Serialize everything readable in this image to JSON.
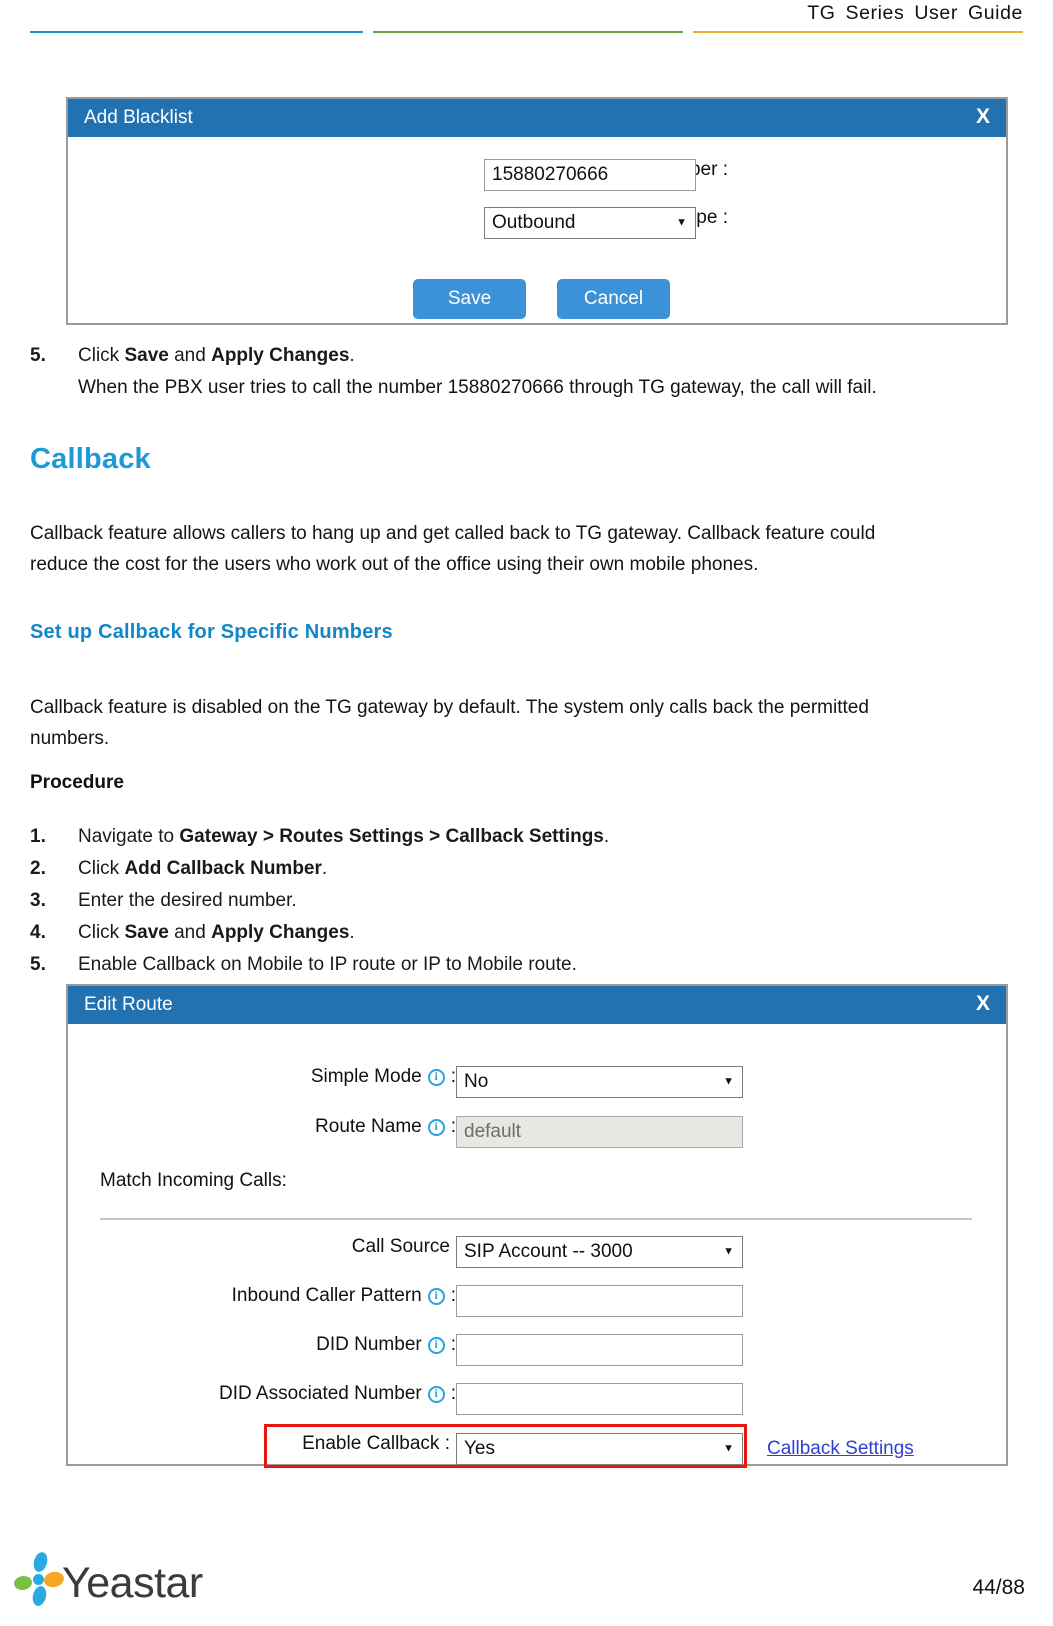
{
  "header": {
    "title": "TG  Series  User  Guide",
    "rule_colors": {
      "blue": "#1f8fd0",
      "green": "#6ba342",
      "yellow": "#ecb02e"
    }
  },
  "blacklist_dialog": {
    "title": "Add Blacklist",
    "close_label": "X",
    "number_label": "Number :",
    "number_value": "15880270666",
    "type_label": "Type :",
    "type_value": "Outbound",
    "save_label": "Save",
    "cancel_label": "Cancel"
  },
  "step5": {
    "num": "5.",
    "text_a": "Click ",
    "bold_a": "Save",
    "text_b": " and ",
    "bold_b": "Apply  Changes",
    "text_c": ".",
    "sub": "When the PBX user tries to call the number 15880270666  through TG gateway,  the call will fail."
  },
  "callback_section": {
    "heading": "Callback",
    "paragraph_line1": "Callback feature allows callers to hang up and get called back to TG gateway. Callback feature could",
    "paragraph_line2": "reduce the cost for  the users who work out of the office using their  own mobile phones.",
    "subheading": "Set up Callback for Specific Numbers",
    "intro_line1": "Callback feature is disabled on the TG gateway by default. The system only calls back the permitted",
    "intro_line2": "numbers.",
    "procedure_label": "Procedure"
  },
  "procedure": {
    "items": [
      {
        "num": "1.",
        "plain1": "Navigate  to ",
        "bold": "Gateway > Routes Settings > Callback Settings",
        "plain2": "."
      },
      {
        "num": "2.",
        "plain1": "Click ",
        "bold": "Add Callback Number",
        "plain2": "."
      },
      {
        "num": "3.",
        "plain1": "Enter the desired number.",
        "bold": "",
        "plain2": ""
      },
      {
        "num": "4.",
        "plain1": "Click ",
        "bold": "Save",
        "plain2": " and ",
        "bold2": "Apply  Changes",
        "plain3": "."
      },
      {
        "num": "5.",
        "plain1": "Enable Callback on Mobile  to IP route or IP to Mobile  route.",
        "bold": "",
        "plain2": ""
      }
    ]
  },
  "route_dialog": {
    "title": "Edit Route",
    "close_label": "X",
    "fields": {
      "simple_mode_label": "Simple Mode",
      "simple_mode_value": "No",
      "route_name_label": "Route Name",
      "route_name_value": "default",
      "match_section_label": "Match Incoming Calls:",
      "call_source_label": "Call Source",
      "call_source_value": "SIP Account -- 3000",
      "inbound_caller_pattern_label": "Inbound Caller Pattern",
      "inbound_caller_pattern_value": "",
      "did_number_label": "DID Number",
      "did_number_value": "",
      "did_associated_number_label": "DID Associated Number",
      "did_associated_number_value": "",
      "enable_callback_label": "Enable Callback :",
      "enable_callback_value": "Yes",
      "callback_settings_link": "Callback Settings"
    },
    "colon": ":",
    "highlight_color": "#e8170f"
  },
  "footer": {
    "logo_text": "Yeastar",
    "page_number": "44/88"
  }
}
